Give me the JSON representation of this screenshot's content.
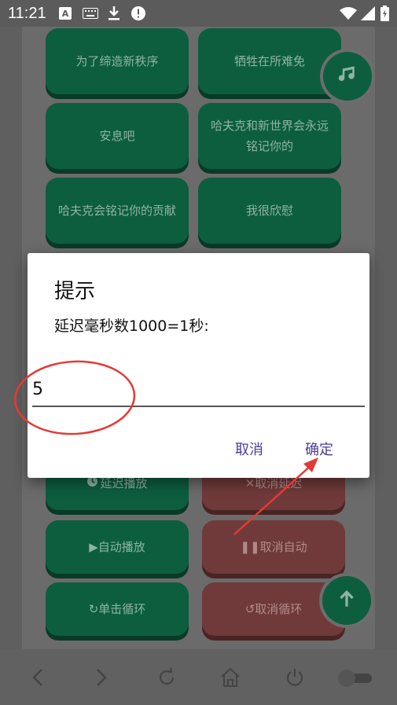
{
  "status_bar": {
    "time": "11:21",
    "icons": [
      "a-notification-icon",
      "keyboard-icon",
      "download-icon",
      "alert-icon",
      "wifi-icon",
      "signal-icon",
      "battery-charging-icon"
    ]
  },
  "buttons": {
    "b1": "为了缔造新秩序",
    "b2": "牺牲在所难免",
    "b3": "安息吧",
    "b4": "哈夫克和新世界会永远铭记你的",
    "b5": "哈夫克会铭记你的贡献",
    "b6": "我很欣慰",
    "delay_play": "延迟播放",
    "cancel_delay": "取消延迟",
    "auto_play": "自动播放",
    "cancel_auto": "取消自动",
    "single_loop": "单击循环",
    "cancel_loop": "取消循环"
  },
  "fabs": {
    "music": "music-icon",
    "scroll_top": "arrow-up-icon"
  },
  "dialog": {
    "title": "提示",
    "message": "延迟毫秒数1000=1秒:",
    "input_value": "5",
    "cancel_label": "取消",
    "ok_label": "确定"
  },
  "colors": {
    "green_button": "#0c5e3f",
    "red_button": "#703a3a",
    "dialog_button_text": "#4c3b9a",
    "annotation_red": "#e53935"
  },
  "navbar": {
    "icons": [
      "back-icon",
      "forward-icon",
      "reload-icon",
      "home-icon",
      "power-icon",
      "toggle-icon"
    ]
  }
}
